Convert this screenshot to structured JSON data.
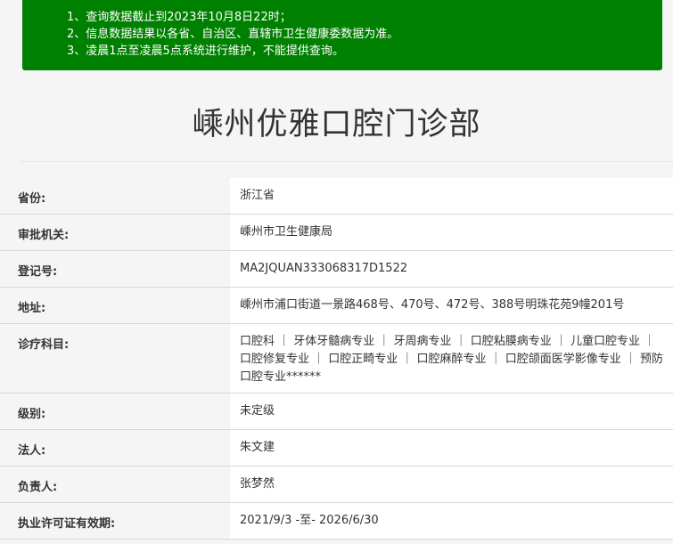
{
  "notice": {
    "lines": [
      "1、查询数据截止到2023年10月8日22时；",
      "2、信息数据结果以各省、自治区、直辖市卫生健康委数据为准。",
      "3、凌晨1点至凌晨5点系统进行维护，不能提供查询。"
    ]
  },
  "page": {
    "title": "嵊州优雅口腔门诊部"
  },
  "details": [
    {
      "label": "省份:",
      "value": "浙江省"
    },
    {
      "label": "审批机关:",
      "value": "嵊州市卫生健康局"
    },
    {
      "label": "登记号:",
      "value": "MA2JQUAN333068317D1522"
    },
    {
      "label": "地址:",
      "value": "嵊州市浦口街道一景路468号、470号、472号、388号明珠花苑9幢201号"
    },
    {
      "label": "诊疗科目:",
      "value": "口腔科 ｜ 牙体牙髓病专业 ｜ 牙周病专业 ｜ 口腔粘膜病专业 ｜ 儿童口腔专业 ｜ 口腔修复专业 ｜ 口腔正畸专业 ｜ 口腔麻醉专业 ｜ 口腔颌面医学影像专业 ｜ 预防口腔专业******"
    },
    {
      "label": "级别:",
      "value": "未定级"
    },
    {
      "label": "法人:",
      "value": "朱文建"
    },
    {
      "label": "负责人:",
      "value": "张梦然"
    },
    {
      "label": "执业许可证有效期:",
      "value": "2021/9/3 -至- 2026/6/30"
    }
  ]
}
